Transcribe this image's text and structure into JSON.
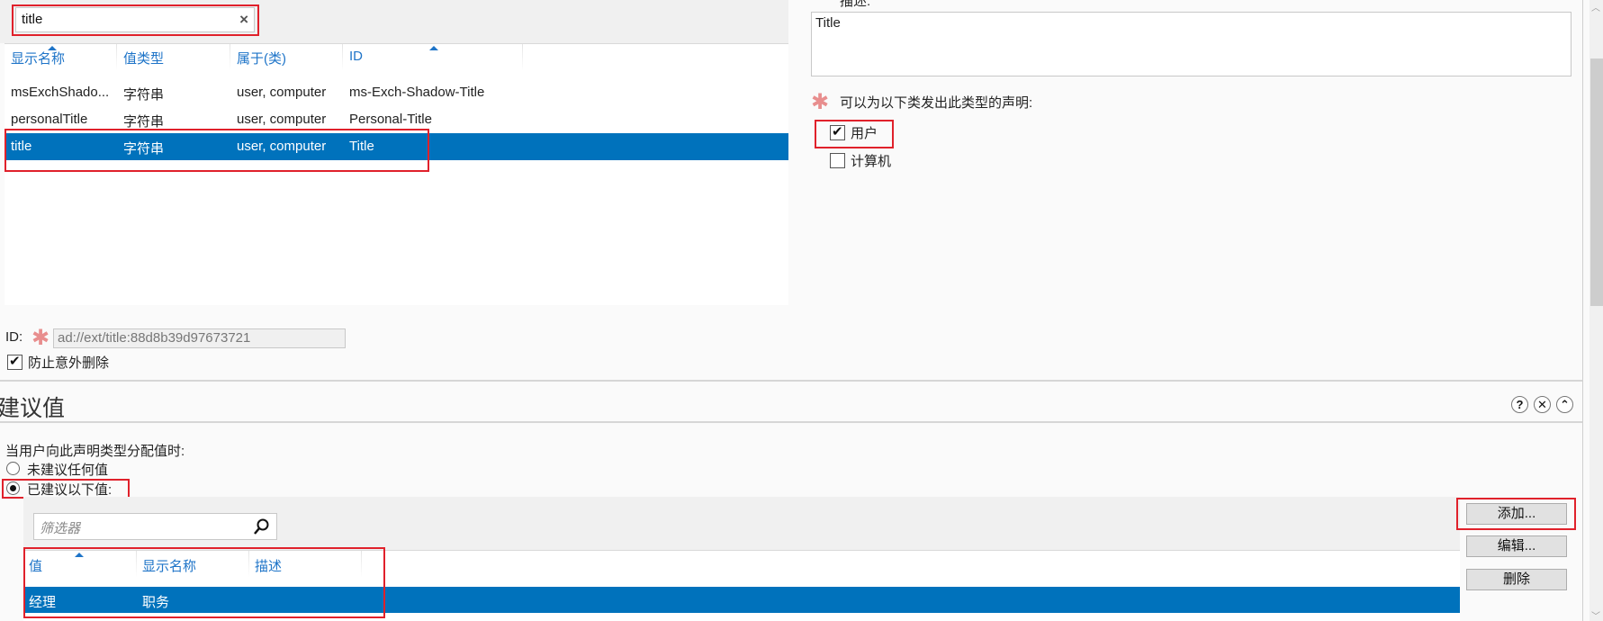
{
  "search": {
    "value": "title",
    "clear_icon": "×"
  },
  "attributes_list": {
    "columns": [
      "显示名称",
      "值类型",
      "属于(类)",
      "ID"
    ],
    "rows": [
      {
        "name": "msExchShado...",
        "type": "字符串",
        "classes": "user, computer",
        "id": "ms-Exch-Shadow-Title",
        "selected": false
      },
      {
        "name": "personalTitle",
        "type": "字符串",
        "classes": "user, computer",
        "id": "Personal-Title",
        "selected": false
      },
      {
        "name": "title",
        "type": "字符串",
        "classes": "user, computer",
        "id": "Title",
        "selected": true
      }
    ]
  },
  "description": {
    "label": "描述:",
    "value": "Title"
  },
  "issue_for": {
    "label": "可以为以下类发出此类型的声明:",
    "options": [
      {
        "label": "用户",
        "checked": true
      },
      {
        "label": "计算机",
        "checked": false
      }
    ]
  },
  "id_field": {
    "label": "ID:",
    "value": "ad://ext/title:88d8b39d97673721"
  },
  "protect_delete": {
    "label": "防止意外删除",
    "checked": true
  },
  "suggested_values": {
    "title": "建议值",
    "icons": {
      "help": "?",
      "close": "✕",
      "collapse": "⌃"
    },
    "prompt": "当用户向此声明类型分配值时:",
    "radio_options": [
      {
        "label": "未建议任何值",
        "selected": false
      },
      {
        "label": "已建议以下值:",
        "selected": true
      }
    ],
    "filter_placeholder": "筛选器",
    "columns": [
      "值",
      "显示名称",
      "描述"
    ],
    "rows": [
      {
        "value": "经理",
        "display_name": "职务",
        "description": "",
        "selected": true
      }
    ],
    "buttons": {
      "add": "添加...",
      "edit": "编辑...",
      "delete": "删除"
    }
  },
  "colors": {
    "selection": "#0072bc",
    "header_text": "#1e74c8",
    "highlight_box": "#e0212b",
    "required_star": "#e88e8e"
  }
}
